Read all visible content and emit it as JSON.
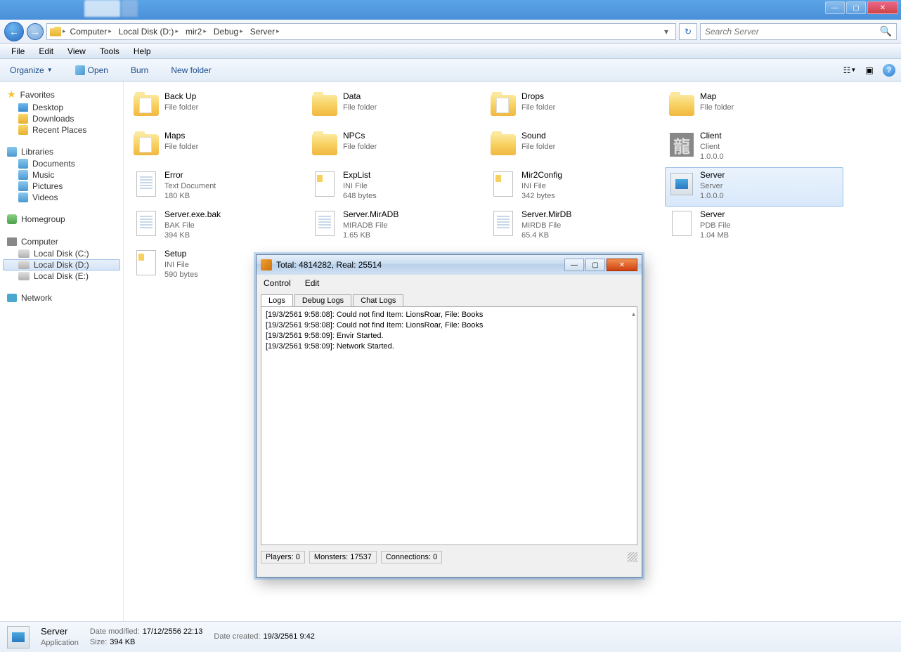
{
  "window_buttons": {
    "min": "—",
    "max": "▢",
    "close": "✕"
  },
  "breadcrumb": [
    "Computer",
    "Local Disk (D:)",
    "mir2",
    "Debug",
    "Server"
  ],
  "search": {
    "placeholder": "Search Server"
  },
  "menubar": [
    "File",
    "Edit",
    "View",
    "Tools",
    "Help"
  ],
  "toolbar": {
    "organize": "Organize",
    "open": "Open",
    "burn": "Burn",
    "newfolder": "New folder"
  },
  "sidebar": {
    "favorites": {
      "head": "Favorites",
      "items": [
        "Desktop",
        "Downloads",
        "Recent Places"
      ]
    },
    "libraries": {
      "head": "Libraries",
      "items": [
        "Documents",
        "Music",
        "Pictures",
        "Videos"
      ]
    },
    "homegroup": {
      "head": "Homegroup"
    },
    "computer": {
      "head": "Computer",
      "items": [
        "Local Disk (C:)",
        "Local Disk (D:)",
        "Local Disk (E:)"
      ]
    },
    "network": {
      "head": "Network"
    }
  },
  "files": [
    {
      "name": "Back Up",
      "type": "File folder",
      "kind": "folder-open"
    },
    {
      "name": "Data",
      "type": "File folder",
      "kind": "folder"
    },
    {
      "name": "Drops",
      "type": "File folder",
      "kind": "folder-open"
    },
    {
      "name": "Map",
      "type": "File folder",
      "kind": "folder"
    },
    {
      "name": "Maps",
      "type": "File folder",
      "kind": "folder-open"
    },
    {
      "name": "NPCs",
      "type": "File folder",
      "kind": "folder"
    },
    {
      "name": "Sound",
      "type": "File folder",
      "kind": "folder"
    },
    {
      "name": "Client",
      "type": "Client",
      "size": "1.0.0.0",
      "kind": "client"
    },
    {
      "name": "Error",
      "type": "Text Document",
      "size": "180 KB",
      "kind": "doc"
    },
    {
      "name": "ExpList",
      "type": "INI File",
      "size": "648 bytes",
      "kind": "ini"
    },
    {
      "name": "Mir2Config",
      "type": "INI File",
      "size": "342 bytes",
      "kind": "ini"
    },
    {
      "name": "Server",
      "type": "Server",
      "size": "1.0.0.0",
      "kind": "exe",
      "selected": true
    },
    {
      "name": "Server.exe.bak",
      "type": "BAK File",
      "size": "394 KB",
      "kind": "doc"
    },
    {
      "name": "Server.MirADB",
      "type": "MIRADB File",
      "size": "1.65 KB",
      "kind": "doc"
    },
    {
      "name": "Server.MirDB",
      "type": "MIRDB File",
      "size": "65.4 KB",
      "kind": "doc"
    },
    {
      "name": "Server",
      "type": "PDB File",
      "size": "1.04 MB",
      "kind": "pdb"
    },
    {
      "name": "Setup",
      "type": "INI File",
      "size": "590 bytes",
      "kind": "ini"
    }
  ],
  "details": {
    "name": "Server",
    "type": "Application",
    "modified_k": "Date modified:",
    "modified_v": "17/12/2556 22:13",
    "size_k": "Size:",
    "size_v": "394 KB",
    "created_k": "Date created:",
    "created_v": "19/3/2561 9:42"
  },
  "app": {
    "title": "Total: 4814282, Real: 25514",
    "menu": [
      "Control",
      "Edit"
    ],
    "tabs": [
      "Logs",
      "Debug Logs",
      "Chat Logs"
    ],
    "logs": [
      "[19/3/2561 9:58:08]: Could not find Item: LionsRoar, File: Books",
      "[19/3/2561 9:58:08]: Could not find Item: LionsRoar, File: Books",
      "[19/3/2561 9:58:09]: Envir Started.",
      "[19/3/2561 9:58:09]: Network Started."
    ],
    "status": {
      "players": "Players: 0",
      "monsters": "Monsters: 17537",
      "connections": "Connections: 0"
    }
  }
}
